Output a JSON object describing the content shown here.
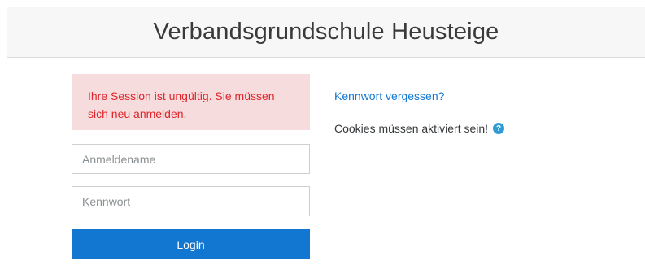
{
  "header": {
    "title": "Verbandsgrundschule Heusteige"
  },
  "alert": {
    "message": "Ihre Session ist ungültig. Sie müssen sich neu anmelden."
  },
  "form": {
    "username_placeholder": "Anmeldename",
    "username_value": "",
    "password_placeholder": "Kennwort",
    "password_value": "",
    "login_label": "Login"
  },
  "side": {
    "forgot_password_label": "Kennwort vergessen?",
    "cookies_notice": "Cookies müssen aktiviert sein!",
    "help_icon": "question-circle-icon",
    "help_glyph": "?"
  },
  "colors": {
    "accent": "#1177d1",
    "alert_bg": "#f6dcdc",
    "alert_text": "#e0242b",
    "help_icon": "#2f9bd6"
  }
}
